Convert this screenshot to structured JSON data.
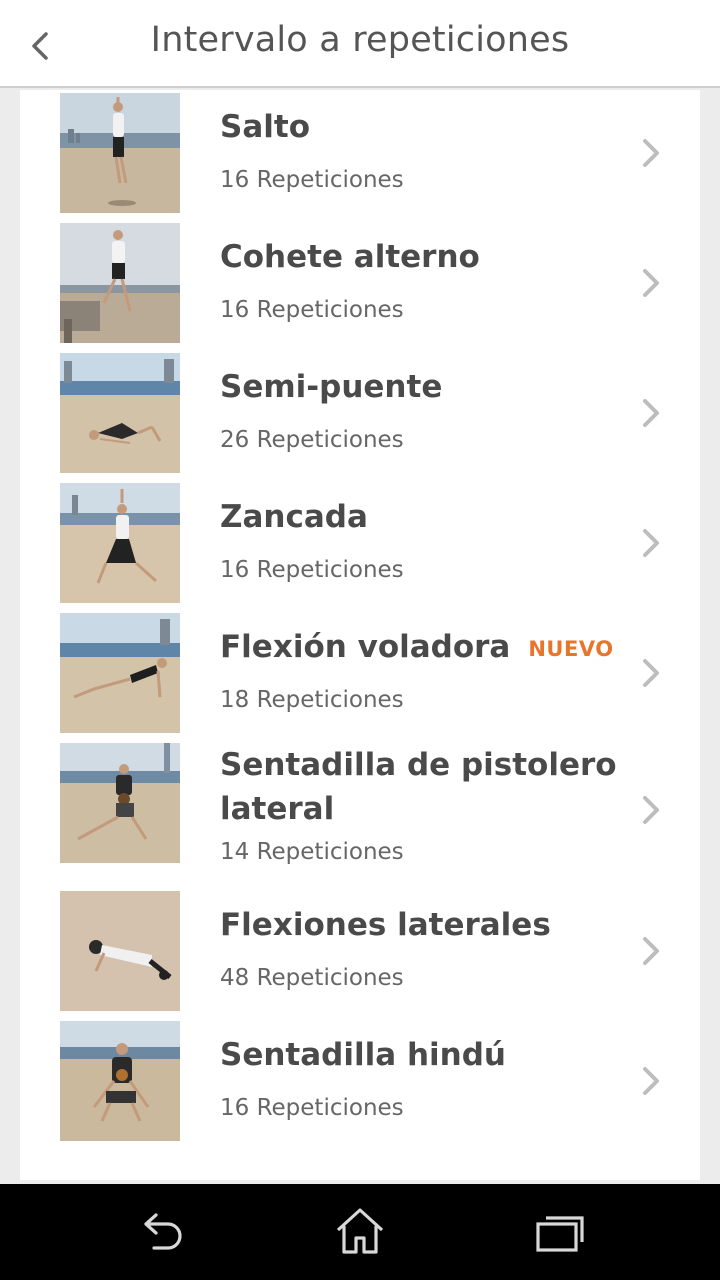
{
  "header": {
    "title": "Intervalo a repeticiones"
  },
  "exercises": [
    {
      "name": "Salto",
      "reps": "16 Repeticiones",
      "badge": ""
    },
    {
      "name": "Cohete alterno",
      "reps": "16 Repeticiones",
      "badge": ""
    },
    {
      "name": "Semi-puente",
      "reps": "26 Repeticiones",
      "badge": ""
    },
    {
      "name": "Zancada",
      "reps": "16 Repeticiones",
      "badge": ""
    },
    {
      "name": "Flexión voladora",
      "reps": "18 Repeticiones",
      "badge": "NUEVO"
    },
    {
      "name": "Sentadilla de pistolero lateral",
      "reps": "14 Repeticiones",
      "badge": ""
    },
    {
      "name": "Flexiones laterales",
      "reps": "48 Repeticiones",
      "badge": ""
    },
    {
      "name": "Sentadilla hindú",
      "reps": "16 Repeticiones",
      "badge": ""
    }
  ],
  "icons": {
    "back": "chevron-left-icon",
    "row_arrow": "chevron-right-icon",
    "nav_back": "back-arrow-icon",
    "nav_home": "home-icon",
    "nav_recents": "recent-apps-icon"
  },
  "colors": {
    "badge": "#e8752c",
    "title": "#4a4a4a",
    "subtitle": "#666666"
  }
}
